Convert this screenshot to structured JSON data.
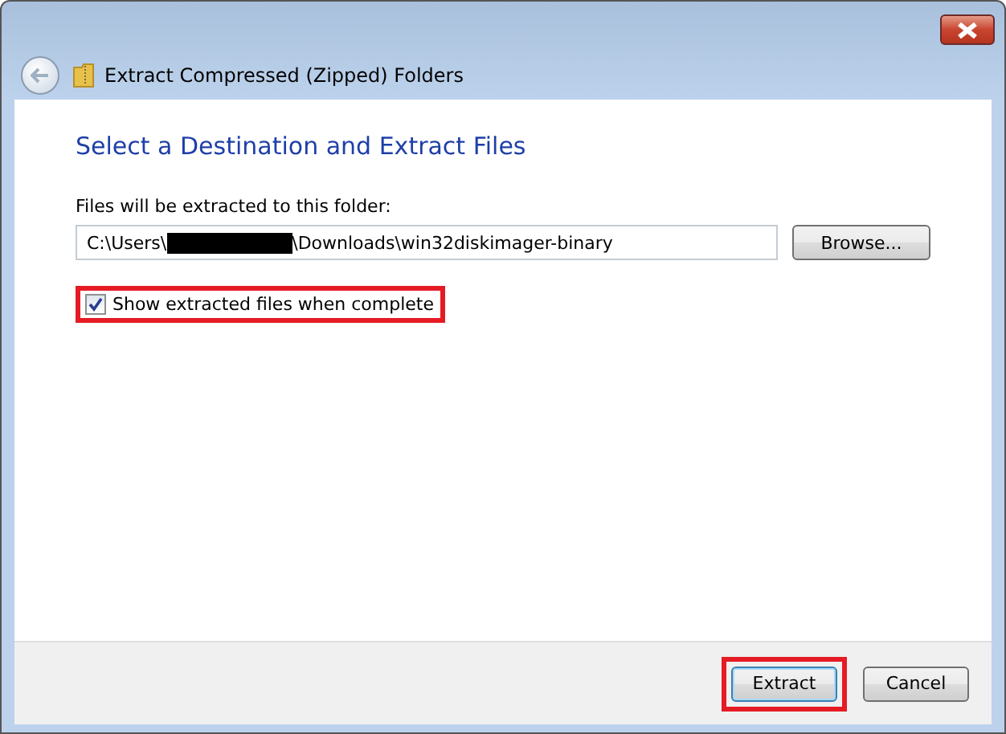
{
  "window": {
    "title": "Extract Compressed (Zipped) Folders"
  },
  "heading": "Select a Destination and Extract Files",
  "destination": {
    "label": "Files will be extracted to this folder:",
    "path_start": "C:\\Users\\",
    "redacted": true,
    "path_end": "\\Downloads\\win32diskimager-binary",
    "browse": "Browse..."
  },
  "show_files": {
    "label": "Show extracted files when complete",
    "checked": true,
    "highlighted": true
  },
  "buttons": [
    {
      "label": "Extract",
      "default": true,
      "highlighted": true
    },
    {
      "label": "Cancel",
      "default": false,
      "highlighted": false
    }
  ]
}
